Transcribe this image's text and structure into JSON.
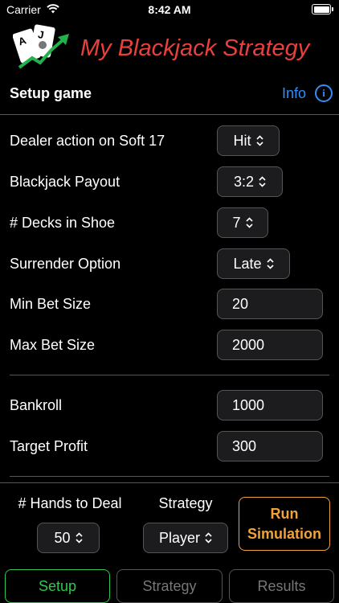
{
  "status_bar": {
    "carrier": "Carrier",
    "time": "8:42 AM"
  },
  "app": {
    "title": "My Blackjack Strategy",
    "logo_icon": "blackjack-cards-chart-icon"
  },
  "setup": {
    "title": "Setup game",
    "info_label": "Info",
    "info_icon": "info-circle-icon"
  },
  "settings": {
    "dealer_soft17": {
      "label": "Dealer action on Soft 17",
      "value": "Hit"
    },
    "payout": {
      "label": "Blackjack Payout",
      "value": "3:2"
    },
    "decks": {
      "label": "# Decks in Shoe",
      "value": "7"
    },
    "surrender": {
      "label": "Surrender Option",
      "value": "Late"
    },
    "min_bet": {
      "label": "Min Bet Size",
      "value": "20"
    },
    "max_bet": {
      "label": "Max Bet Size",
      "value": "2000"
    },
    "bankroll": {
      "label": "Bankroll",
      "value": "1000"
    },
    "target_profit": {
      "label": "Target Profit",
      "value": "300"
    }
  },
  "simulation": {
    "hands_label": "# Hands to Deal",
    "hands_value": "50",
    "strategy_label": "Strategy",
    "strategy_value": "Player",
    "run_button": "Run Simulation"
  },
  "tabs": [
    {
      "label": "Setup",
      "active": true
    },
    {
      "label": "Strategy",
      "active": false
    },
    {
      "label": "Results",
      "active": false
    }
  ],
  "colors": {
    "accent_red": "#e8413d",
    "link_blue": "#2f8ffa",
    "run_orange": "#f0a33a",
    "active_green": "#2fc84f"
  }
}
